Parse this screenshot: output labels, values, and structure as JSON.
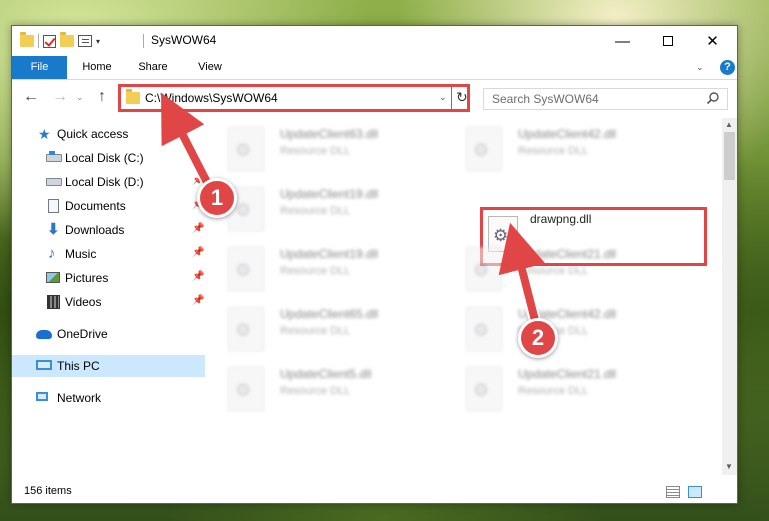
{
  "window": {
    "title": "SysWOW64",
    "controls": {
      "minimize": "—",
      "close": "✕"
    }
  },
  "ribbon": {
    "tabs": [
      "File",
      "Home",
      "Share",
      "View"
    ],
    "expand": "⌄",
    "help": "?"
  },
  "navigation": {
    "back": "←",
    "forward": "→",
    "recent": "⌄",
    "up": "↑",
    "address": "C:\\Windows\\SysWOW64",
    "address_dropdown": "⌄",
    "refresh": "↻",
    "search_placeholder": "Search SysWOW64"
  },
  "sidebar": {
    "quick_access": "Quick access",
    "items": [
      {
        "label": "Local Disk (C:)",
        "icon": "disk-icon",
        "pin": "✦"
      },
      {
        "label": "Local Disk (D:)",
        "icon": "disk-icon",
        "pin": "📌"
      },
      {
        "label": "Documents",
        "icon": "documents-icon",
        "pin": "📌"
      },
      {
        "label": "Downloads",
        "icon": "downloads-icon",
        "pin": "📌"
      },
      {
        "label": "Music",
        "icon": "music-icon",
        "pin": "📌"
      },
      {
        "label": "Pictures",
        "icon": "pictures-icon",
        "pin": "📌"
      },
      {
        "label": "Videos",
        "icon": "videos-icon",
        "pin": "📌"
      }
    ],
    "onedrive": "OneDrive",
    "this_pc": "This PC",
    "network": "Network"
  },
  "files": [
    {
      "name": "UpdateClient63.dll",
      "type": "Resource DLL"
    },
    {
      "name": "UpdateClient42.dll",
      "type": "Resource DLL"
    },
    {
      "name": "UpdateClient19.dll",
      "type": "Resource DLL"
    },
    {
      "name": "drawpng.dll",
      "type": ""
    },
    {
      "name": "UpdateClient19.dll",
      "type": "Resource DLL"
    },
    {
      "name": "UpdateClient21.dll",
      "type": "Resource DLL"
    },
    {
      "name": "UpdateClient65.dll",
      "type": "Resource DLL"
    },
    {
      "name": "UpdateClient42.dll",
      "type": "Resource DLL"
    },
    {
      "name": "UpdateClient5.dll",
      "type": "Resource DLL"
    },
    {
      "name": "UpdateClient21.dll",
      "type": "Resource DLL"
    }
  ],
  "status": {
    "item_count": "156 items"
  },
  "annotations": {
    "badge_1": "1",
    "badge_2": "2",
    "color": "#e04646"
  },
  "colors": {
    "accent": "#1979ca",
    "highlight": "#e04646",
    "selection": "#cce8ff"
  }
}
